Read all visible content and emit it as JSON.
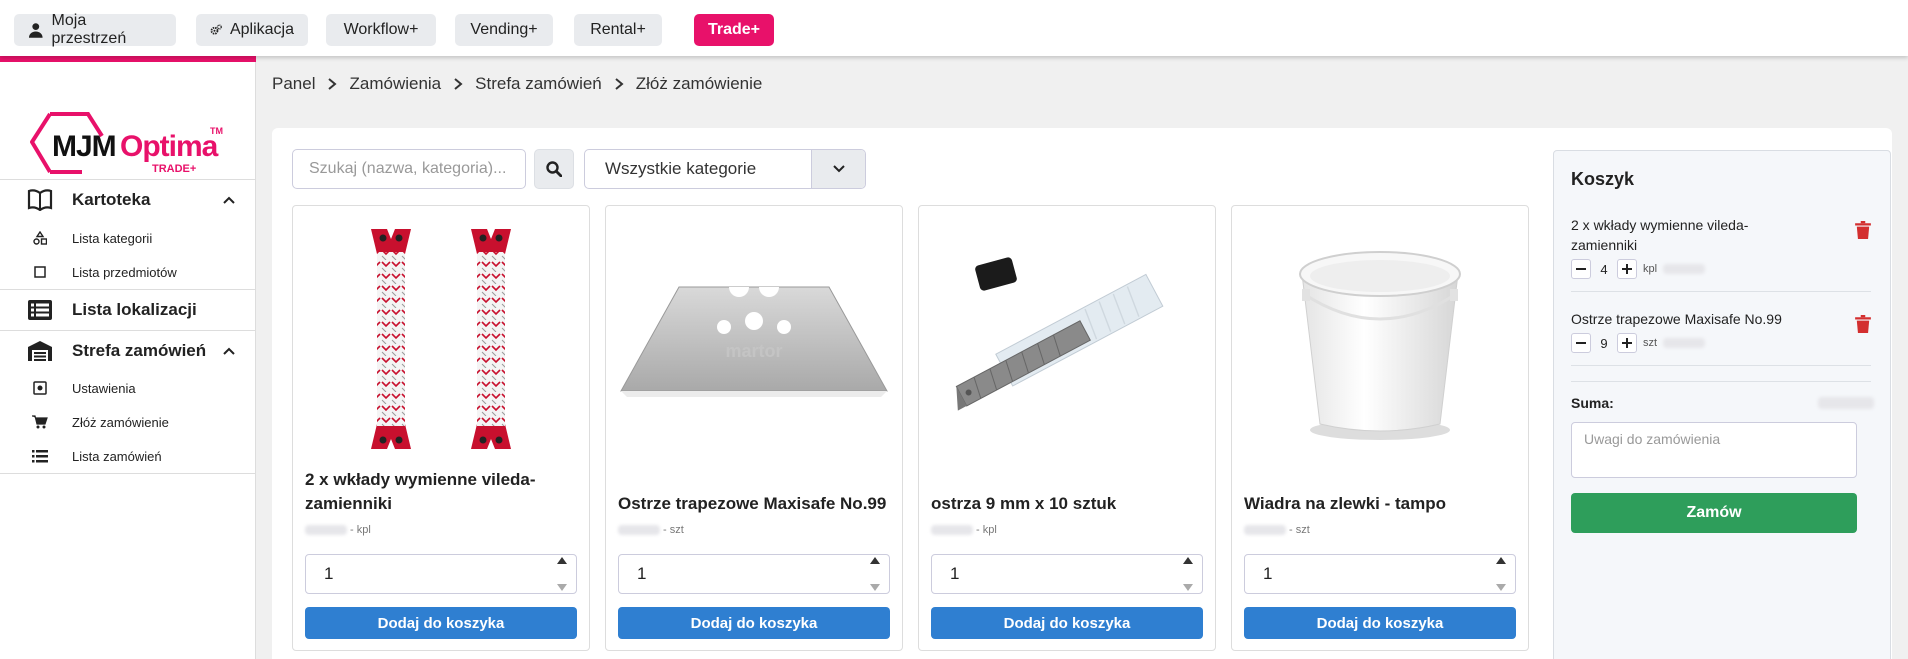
{
  "topnav": {
    "items": [
      {
        "label": "Moja przestrzeń",
        "icon": "user-icon"
      },
      {
        "label": "Aplikacja",
        "icon": "cogs-icon"
      },
      {
        "label": "Workflow+"
      },
      {
        "label": "Vending+"
      },
      {
        "label": "Rental+"
      },
      {
        "label": "Trade+",
        "active": true
      }
    ],
    "accent_color": "#e8116a"
  },
  "logo": {
    "brand_a": "MJM",
    "brand_b": "Optima",
    "tm": "TM",
    "sub": "TRADE+"
  },
  "sidebar": {
    "kartoteka": {
      "label": "Kartoteka",
      "items": [
        {
          "label": "Lista kategorii",
          "icon": "shapes-icon"
        },
        {
          "label": "Lista przedmiotów",
          "icon": "square-icon"
        }
      ]
    },
    "lokalizacje": {
      "label": "Lista lokalizacji"
    },
    "strefa": {
      "label": "Strefa zamówień",
      "items": [
        {
          "label": "Ustawienia",
          "icon": "settings-icon"
        },
        {
          "label": "Złóż zamówienie",
          "icon": "cart-icon"
        },
        {
          "label": "Lista zamówień",
          "icon": "list-icon"
        }
      ]
    }
  },
  "breadcrumb": [
    "Panel",
    "Zamówienia",
    "Strefa zamówień",
    "Złóż zamówienie"
  ],
  "search": {
    "placeholder": "Szukaj (nazwa, kategoria)...",
    "value": ""
  },
  "category_select": {
    "value": "Wszystkie kategorie"
  },
  "products": [
    {
      "name": "2 x wkłady wymienne vileda-zamienniki",
      "unit": "- kpl",
      "qty": "1",
      "add_label": "Dodaj do koszyka",
      "image": "mop-pads"
    },
    {
      "name": "Ostrze trapezowe Maxisafe No.99",
      "unit": "- szt",
      "qty": "1",
      "add_label": "Dodaj do koszyka",
      "image": "trapezoid-blade",
      "blade_text": "martor"
    },
    {
      "name": "ostrza 9 mm x 10 sztuk",
      "unit": "- kpl",
      "qty": "1",
      "add_label": "Dodaj do koszyka",
      "image": "snap-off-blades"
    },
    {
      "name": "Wiadra na zlewki - tampo",
      "unit": "- szt",
      "qty": "1",
      "add_label": "Dodaj do koszyka",
      "image": "bucket"
    }
  ],
  "cart": {
    "title": "Koszyk",
    "items": [
      {
        "name": "2 x wkłady wymienne vileda-zamienniki",
        "qty": "4",
        "unit": "kpl"
      },
      {
        "name": "Ostrze trapezowe Maxisafe No.99",
        "qty": "9",
        "unit": "szt"
      }
    ],
    "sum_label": "Suma:",
    "notes_placeholder": "Uwagi do zamówienia",
    "order_label": "Zamów",
    "order_color": "#2e9e5b",
    "delete_color": "#d32f2f"
  },
  "add_button_color": "#2f7fd1"
}
